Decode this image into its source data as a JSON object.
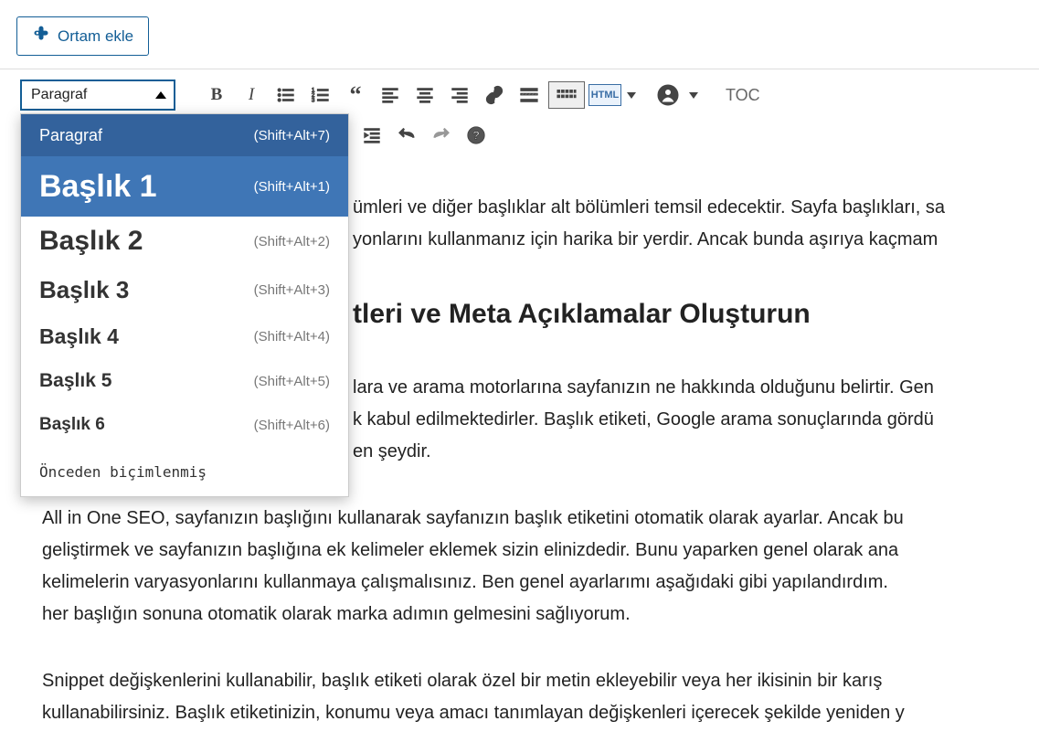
{
  "media_button_label": "Ortam ekle",
  "format_select": {
    "current": "Paragraf"
  },
  "toolbar": {
    "toc_label": "TOC",
    "html_label": "HTML"
  },
  "format_menu": {
    "items": [
      {
        "label": "Paragraf",
        "shortcut": "(Shift+Alt+7)",
        "cls": "fmt-para",
        "state": "selected"
      },
      {
        "label": "Başlık 1",
        "shortcut": "(Shift+Alt+1)",
        "cls": "fmt-h1",
        "state": "hovered"
      },
      {
        "label": "Başlık 2",
        "shortcut": "(Shift+Alt+2)",
        "cls": "fmt-h2",
        "state": ""
      },
      {
        "label": "Başlık 3",
        "shortcut": "(Shift+Alt+3)",
        "cls": "fmt-h3",
        "state": ""
      },
      {
        "label": "Başlık 4",
        "shortcut": "(Shift+Alt+4)",
        "cls": "fmt-h4",
        "state": ""
      },
      {
        "label": "Başlık 5",
        "shortcut": "(Shift+Alt+5)",
        "cls": "fmt-h5",
        "state": ""
      },
      {
        "label": "Başlık 6",
        "shortcut": "(Shift+Alt+6)",
        "cls": "fmt-h6",
        "state": ""
      },
      {
        "label": "Önceden biçimlenmiş",
        "shortcut": "",
        "cls": "fmt-pre",
        "state": ""
      }
    ]
  },
  "content": {
    "p1": "ümleri ve diğer başlıklar alt bölümleri temsil edecektir. Sayfa başlıkları, sa",
    "p1b": "yonlarını kullanmanız için harika bir yerdir. Ancak bunda aşırıya kaçmam",
    "h2": "tleri ve Meta Açıklamalar Oluşturun",
    "p2": "lara ve arama motorlarına sayfanızın ne hakkında olduğunu belirtir. Gen",
    "p2b": "k kabul edilmektedirler. Başlık etiketi, Google arama sonuçlarında gördü",
    "p2c": "en şeydir.",
    "p3": "All in One SEO, sayfanızın başlığını kullanarak sayfanızın başlık etiketini otomatik olarak ayarlar. Ancak bu",
    "p3b": "geliştirmek ve sayfanızın başlığına ek kelimeler eklemek sizin elinizdedir. Bunu yaparken genel olarak ana",
    "p3c": "kelimelerin varyasyonlarını kullanmaya çalışmalısınız. Ben genel ayarlarımı aşağıdaki gibi yapılandırdım. ",
    "p3d": "her başlığın sonuna otomatik olarak marka adımın gelmesini sağlıyorum.",
    "p4": "Snippet değişkenlerini kullanabilir, başlık etiketi olarak özel bir metin ekleyebilir veya her ikisinin bir karış",
    "p4b": "kullanabilirsiniz. Başlık etiketinizin, konumu veya amacı tanımlayan değişkenleri içerecek şekilde yeniden y"
  }
}
